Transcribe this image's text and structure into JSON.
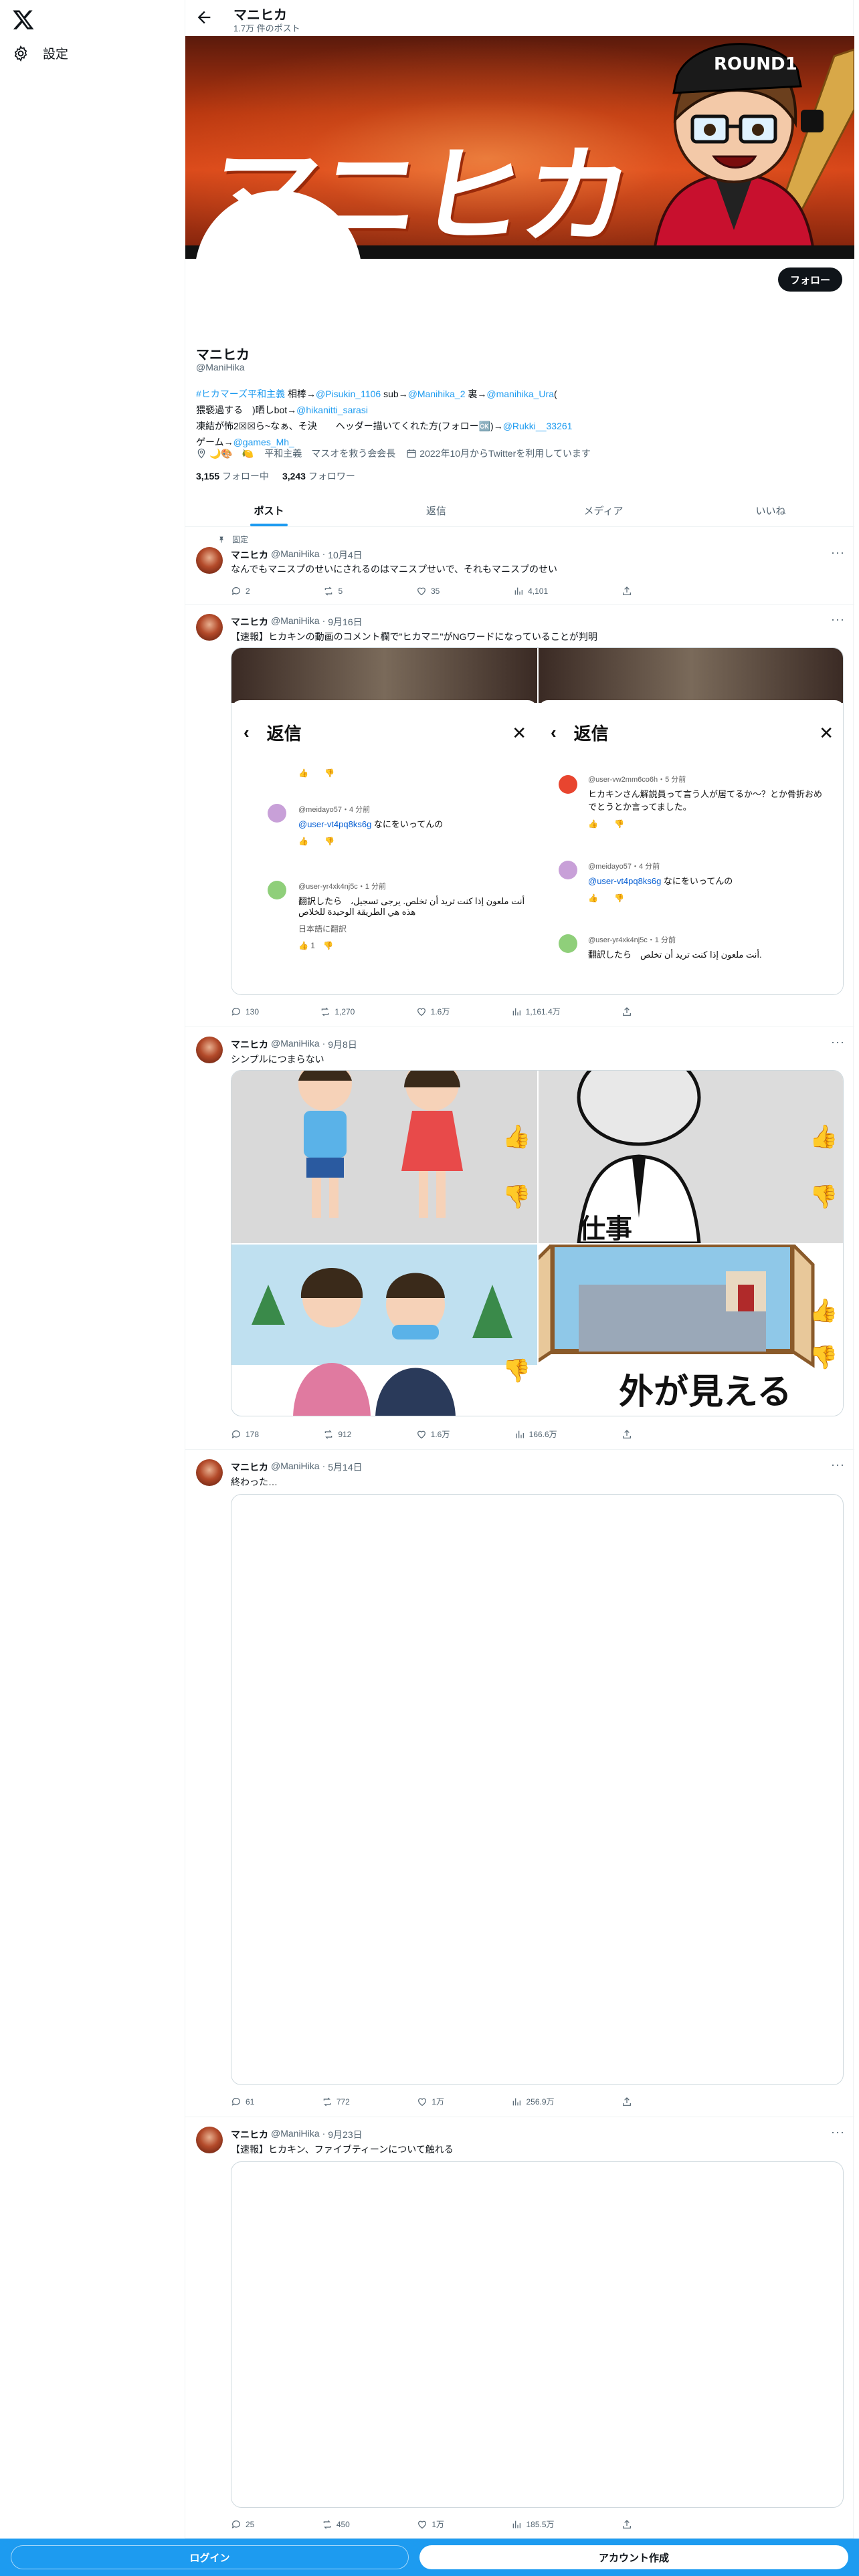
{
  "sidebar": {
    "settings_label": "設定"
  },
  "header": {
    "name": "マニヒカ",
    "post_count": "1.7万 件のポスト"
  },
  "banner": {
    "title_text": "マニヒカ"
  },
  "profile": {
    "follow_label": "フォロー",
    "name": "マニヒカ",
    "handle": "@ManiHika",
    "bio": {
      "line1_a": "#ヒカマーズ平和主義",
      "line1_b": " 相棒→",
      "line1_c": "@Pisukin_1106",
      "line1_d": " sub→",
      "line1_e": "@Manihika_2",
      "line1_f": " 裏→",
      "line1_g": "@manihika_Ura",
      "line1_h": "(",
      "line2_a": "猥褻過する　)晒しbot→",
      "line2_b": "@hikanitti_sarasi",
      "line3_a": "凍結が怖2☒☒ら~なぁ、そ決　　ヘッダー描いてくれた方(フォロー🆗)→",
      "line3_b": "@Rukki__33261",
      "line4_a": "ゲーム→",
      "line4_b": "@games_Mh_"
    },
    "meta_emoji": "🌙🎨　🍋",
    "meta_desc": "平和主義　マスオを救う会会長",
    "joined": "2022年10月からTwitterを利用しています",
    "following_count": "3,155",
    "following_label": "フォロー中",
    "followers_count": "3,243",
    "followers_label": "フォロワー"
  },
  "tabs": [
    "ポスト",
    "返信",
    "メディア",
    "いいね"
  ],
  "posts": [
    {
      "pinned_label": "固定",
      "name": "マニヒカ",
      "handle": "@ManiHika",
      "date": "10月4日",
      "text": "なんでもマニスプのせいにされるのはマニスプせいで、それもマニスプのせい",
      "replies": "2",
      "reposts": "5",
      "likes": "35",
      "views": "4,101"
    },
    {
      "name": "マニヒカ",
      "handle": "@ManiHika",
      "date": "9月16日",
      "text": "【速報】ヒカキンの動画のコメント欄で\"ヒカマニ\"がNGワードになっていることが判明",
      "replies": "130",
      "reposts": "1,270",
      "likes": "1.6万",
      "views": "1,161.4万",
      "panel_title": "返信",
      "left_comments": [
        {
          "user": "@meidayo57・4 分前",
          "mention": "@user-vt4pq8ks6g",
          "body": " なにをいってんの"
        },
        {
          "user": "@user-yr4xk4nj5c・1 分前",
          "mention": "",
          "body": "翻訳したら　أنت ملعون إذا كنت تريد أن تخلص. يرجى تسجيل، هذه هي الطريقة الوحيدة للخلاص",
          "extra": "日本語に翻訳",
          "likes": "1"
        }
      ],
      "right_comments": [
        {
          "user": "@user-vw2mm6co6h・5 分前",
          "mention": "",
          "body": "ヒカキンさん解説員って言う人が居てるか〜？とか骨折おめでとうとか言ってました。"
        },
        {
          "user": "@meidayo57・4 分前",
          "mention": "@user-vt4pq8ks6g",
          "body": " なにをいってんの"
        },
        {
          "user": "@user-yr4xk4nj5c・1 分前",
          "mention": "",
          "body": "翻訳したら　أنت ملعون إذا كنت تريد أن تخلص."
        }
      ]
    },
    {
      "name": "マニヒカ",
      "handle": "@ManiHika",
      "date": "9月8日",
      "text": "シンプルにつまらない",
      "replies": "178",
      "reposts": "912",
      "likes": "1.6万",
      "views": "166.6万",
      "caption_br": "外が見える"
    },
    {
      "name": "マニヒカ",
      "handle": "@ManiHika",
      "date": "5月14日",
      "text": "終わった…",
      "replies": "61",
      "reposts": "772",
      "likes": "1万",
      "views": "256.9万"
    },
    {
      "name": "マニヒカ",
      "handle": "@ManiHika",
      "date": "9月23日",
      "text": "【速報】ヒカキン、ファイブティーンについて触れる",
      "replies": "25",
      "reposts": "450",
      "likes": "1万",
      "views": "185.5万"
    }
  ],
  "bottom_bar": {
    "login_label": "ログイン",
    "signup_label": "アカウント作成"
  },
  "colors": {
    "accent": "#1d9bf0",
    "text": "#0f1419",
    "secondary": "#536471",
    "border": "#eff3f4"
  }
}
